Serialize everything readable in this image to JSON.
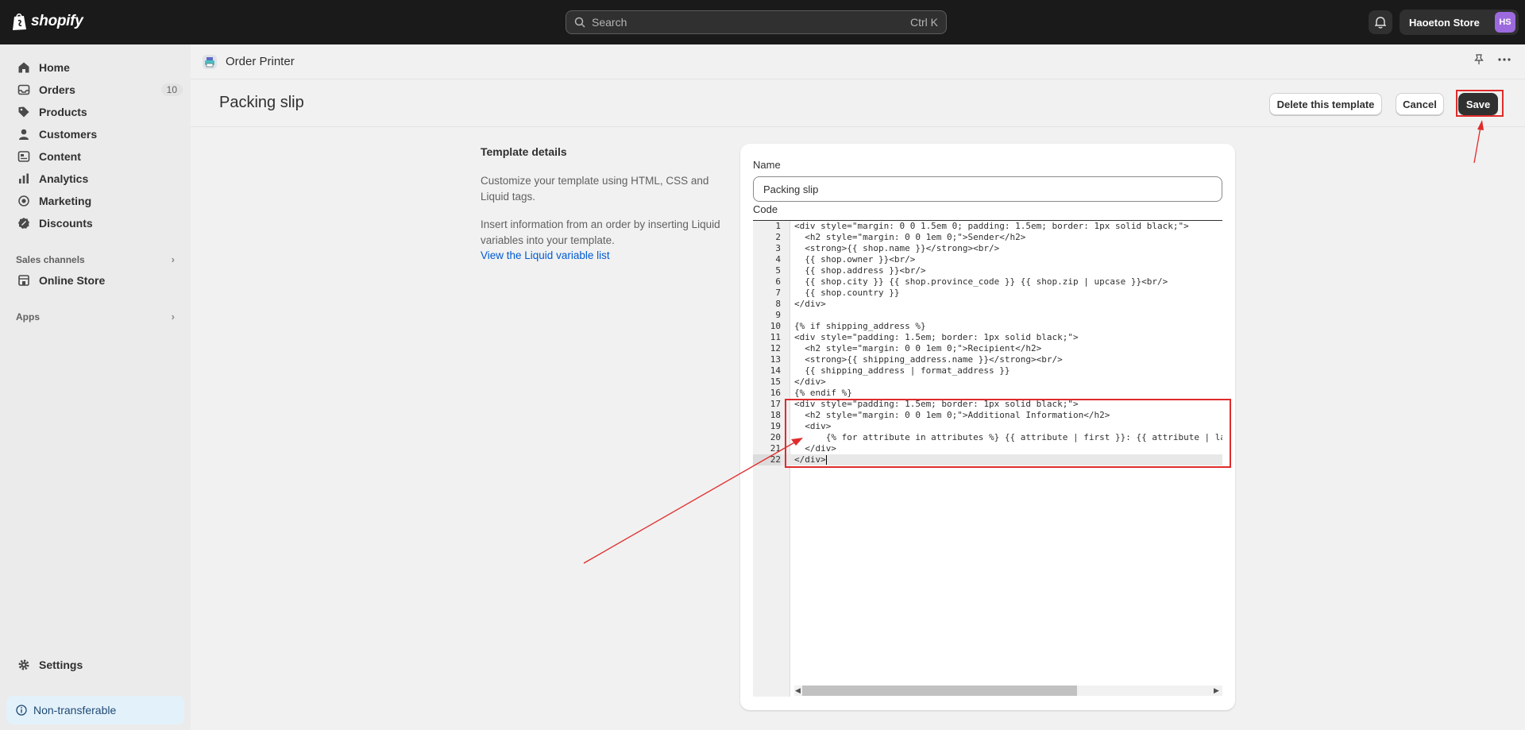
{
  "topbar": {
    "logo_text": "shopify",
    "search_placeholder": "Search",
    "search_shortcut": "Ctrl K",
    "store_name": "Haoeton Store",
    "avatar_initials": "HS",
    "avatar_color": "#9c6ade"
  },
  "sidebar": {
    "items": [
      {
        "label": "Home",
        "icon": "home-icon"
      },
      {
        "label": "Orders",
        "icon": "orders-icon",
        "count": "10"
      },
      {
        "label": "Products",
        "icon": "tag-icon"
      },
      {
        "label": "Customers",
        "icon": "person-icon"
      },
      {
        "label": "Content",
        "icon": "content-icon"
      },
      {
        "label": "Analytics",
        "icon": "chart-icon"
      },
      {
        "label": "Marketing",
        "icon": "target-icon"
      },
      {
        "label": "Discounts",
        "icon": "discount-icon"
      }
    ],
    "sales_channels_label": "Sales channels",
    "online_store_label": "Online Store",
    "apps_label": "Apps",
    "settings_label": "Settings",
    "non_transferable_label": "Non-transferable"
  },
  "appbar": {
    "app_name": "Order Printer"
  },
  "page": {
    "title": "Packing slip",
    "delete_label": "Delete this template",
    "cancel_label": "Cancel",
    "save_label": "Save"
  },
  "details": {
    "title": "Template details",
    "para1": "Customize your template using HTML, CSS and Liquid tags.",
    "para2": "Insert information from an order by inserting Liquid variables into your template.",
    "link": "View the Liquid variable list"
  },
  "form": {
    "name_label": "Name",
    "name_value": "Packing slip",
    "code_label": "Code"
  },
  "code_lines": [
    "<div style=\"margin: 0 0 1.5em 0; padding: 1.5em; border: 1px solid black;\">",
    "  <h2 style=\"margin: 0 0 1em 0;\">Sender</h2>",
    "  <strong>{{ shop.name }}</strong><br/>",
    "  {{ shop.owner }}<br/>",
    "  {{ shop.address }}<br/>",
    "  {{ shop.city }} {{ shop.province_code }} {{ shop.zip | upcase }}<br/>",
    "  {{ shop.country }}",
    "</div>",
    "",
    "{% if shipping_address %}",
    "<div style=\"padding: 1.5em; border: 1px solid black;\">",
    "  <h2 style=\"margin: 0 0 1em 0;\">Recipient</h2>",
    "  <strong>{{ shipping_address.name }}</strong><br/>",
    "  {{ shipping_address | format_address }}",
    "</div>",
    "{% endif %}",
    "<div style=\"padding: 1.5em; border: 1px solid black;\">",
    "  <h2 style=\"margin: 0 0 1em 0;\">Additional Information</h2>",
    "  <div>",
    "      {% for attribute in attributes %} {{ attribute | first }}: {{ attribute | la",
    "  </div>",
    "</div>"
  ],
  "colors": {
    "highlight": "#e02b2b",
    "link": "#005bd3",
    "save_bg": "#303030"
  }
}
